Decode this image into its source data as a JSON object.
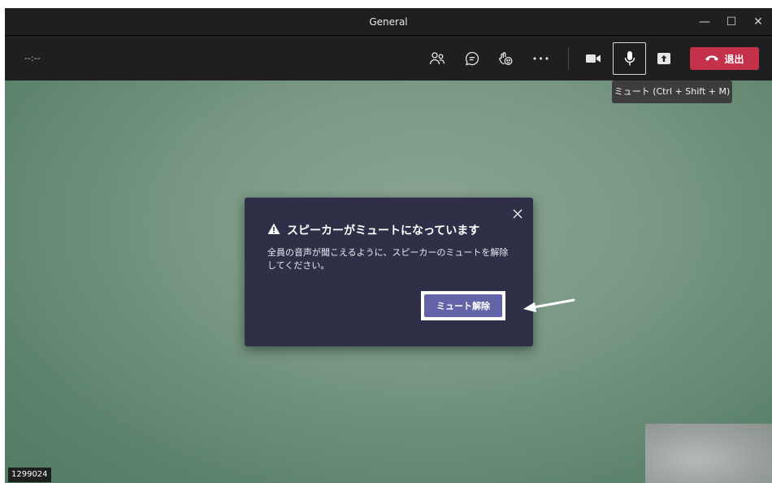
{
  "window": {
    "title": "General",
    "controls": {
      "minimize": "—",
      "maximize": "☐",
      "close": "✕"
    }
  },
  "toolbar": {
    "timer": "--:--",
    "icons": {
      "participants": "people-icon",
      "chat": "chat-icon",
      "reactions": "raise-hand-icon",
      "more": "more-icon",
      "camera": "camera-icon",
      "mic": "microphone-icon",
      "share": "share-screen-icon",
      "leave": "phone-hangup-icon"
    },
    "more_label": "•••",
    "leave_label": "退出"
  },
  "tooltip": {
    "text": "ミュート (Ctrl + Shift + M)"
  },
  "video": {
    "participant_id": "1299024"
  },
  "dialog": {
    "title": "スピーカーがミュートになっています",
    "body": "全員の音声が聞こえるように、スピーカーのミュートを解除してください。",
    "button_label": "ミュート解除",
    "close_label": "✕"
  },
  "colors": {
    "dialog_bg": "#2f2f47",
    "primary_button": "#6264a7",
    "leave_button": "#c4314b",
    "toolbar_bg": "#1f1f1f"
  }
}
